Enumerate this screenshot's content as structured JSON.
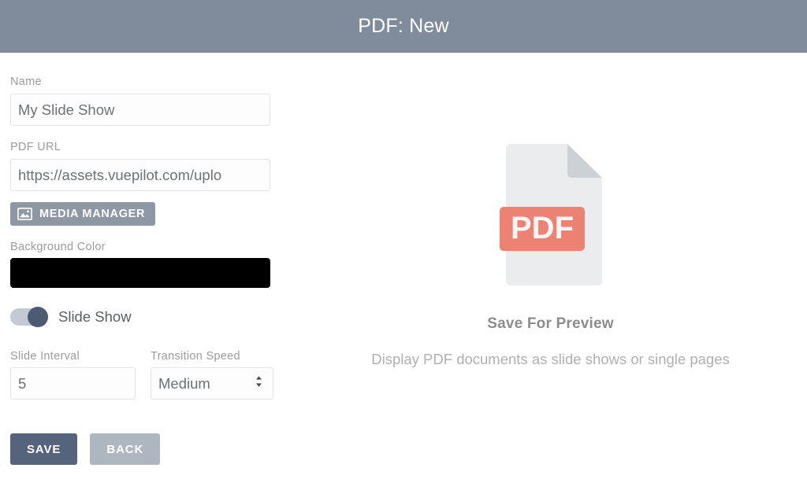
{
  "header": {
    "title": "PDF: New"
  },
  "form": {
    "name": {
      "label": "Name",
      "value": "My Slide Show"
    },
    "pdf_url": {
      "label": "PDF URL",
      "value": "https://assets.vuepilot.com/uplo"
    },
    "media_manager": {
      "label": "MEDIA MANAGER",
      "icon": "image-icon"
    },
    "background_color": {
      "label": "Background Color",
      "value": "#000000"
    },
    "slide_show": {
      "label": "Slide Show",
      "state": "on"
    },
    "slide_interval": {
      "label": "Slide Interval",
      "value": "5"
    },
    "transition_speed": {
      "label": "Transition Speed",
      "value": "Medium",
      "options": [
        "Medium"
      ]
    },
    "save_label": "SAVE",
    "back_label": "BACK"
  },
  "preview": {
    "icon_label": "PDF",
    "title": "Save For Preview",
    "subtitle": "Display PDF documents as slide shows or single pages"
  },
  "colors": {
    "header_bar": "#808c9c",
    "save_button": "#56637c",
    "back_button": "#aeb6bf",
    "media_button": "#8e97a4",
    "toggle_knob": "#4c5a73",
    "pdf_badge": "#ee8272",
    "pdf_page": "#eaecee"
  }
}
